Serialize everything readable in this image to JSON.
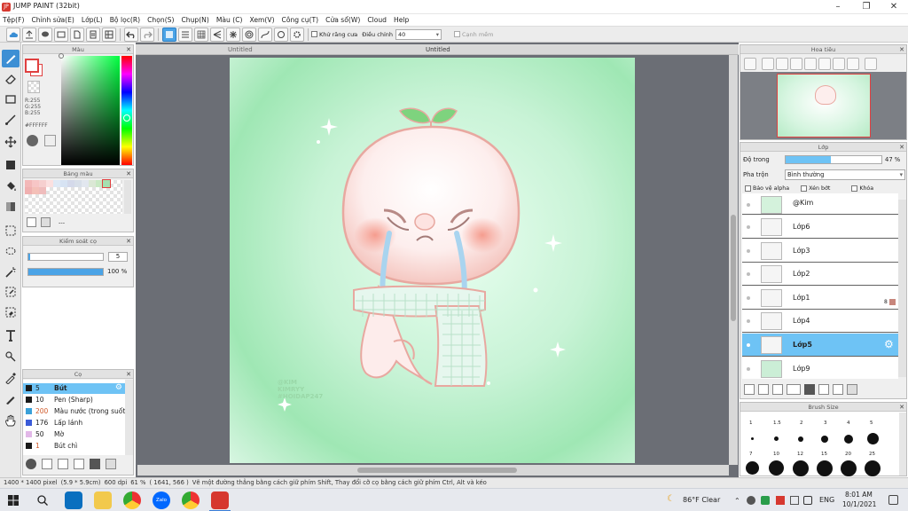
{
  "window": {
    "title": "JUMP PAINT (32bit)",
    "icon_text": "JP"
  },
  "menu": [
    "Tệp(F)",
    "Chỉnh sửa(E)",
    "Lớp(L)",
    "Bộ lọc(R)",
    "Chọn(S)",
    "Chụp(N)",
    "Màu (C)",
    "Xem(V)",
    "Công cụ(T)",
    "Cửa sổ(W)",
    "Cloud",
    "Help"
  ],
  "toolbar": {
    "antialias_label": "Khử răng cưa",
    "correction_label": "Điều chỉnh",
    "correction_value": "40",
    "edge_label": "Cạnh mềm"
  },
  "color_panel": {
    "title": "Màu",
    "r": "R:255",
    "g": "G:255",
    "b": "B:255",
    "hex": "#FFFFFF"
  },
  "swatch_panel": {
    "title": "Bảng màu",
    "dashes": "---"
  },
  "brush_control": {
    "title": "Kiểm soát cọ",
    "size": "5",
    "opacity": "100 %"
  },
  "brush_panel": {
    "title": "Cọ",
    "items": [
      {
        "size": "5",
        "name": "Bút",
        "color": "#1a1a1a"
      },
      {
        "size": "10",
        "name": "Pen (Sharp)",
        "color": "#1a1a1a"
      },
      {
        "size": "200",
        "name": "Màu nước (trong suốt)",
        "color": "#3aa0d8"
      },
      {
        "size": "176",
        "name": "Lấp lánh",
        "color": "#3a5bd8"
      },
      {
        "size": "50",
        "name": "Mờ",
        "color": "#e2b8e8"
      },
      {
        "size": "1",
        "name": "Bút chì",
        "color": "#1a1a1a"
      }
    ]
  },
  "document": {
    "tab_left": "Untitled",
    "tab_right": "Untitled"
  },
  "artwork": {
    "watermark_1": "@KIM",
    "watermark_2": "KIMRYY",
    "watermark_3": "#HOIDAP247"
  },
  "navigator": {
    "title": "Hoa tiêu"
  },
  "layers_panel": {
    "title": "Lớp",
    "opacity_label": "Độ trong",
    "opacity_value": "47 %",
    "blend_label": "Pha trộn",
    "blend_value": "Bình thường",
    "protect_alpha": "Bảo vệ alpha",
    "clipping": "Xén bớt",
    "lock": "Khóa",
    "layers": [
      {
        "name": "@Kim",
        "selected": false
      },
      {
        "name": "Lớp6",
        "selected": false
      },
      {
        "name": "Lớp3",
        "selected": false
      },
      {
        "name": "Lớp2",
        "selected": false
      },
      {
        "name": "Lớp1",
        "selected": false
      },
      {
        "name": "Lớp4",
        "selected": false
      },
      {
        "name": "Lớp5",
        "selected": true
      },
      {
        "name": "Lớp9",
        "selected": false
      }
    ],
    "layer1_badge": "8"
  },
  "brush_size_panel": {
    "title": "Brush Size",
    "row1": [
      "1",
      "1.5",
      "2",
      "3",
      "4",
      "5"
    ],
    "row2": [
      "7",
      "10",
      "12",
      "15",
      "20",
      "25"
    ]
  },
  "status": {
    "dimensions": "1400 * 1400 pixel",
    "physical": "(5.9 * 5.9cm)",
    "dpi": "600 dpi",
    "zoom": "61 %",
    "coords": "( 1641, 566 )",
    "hint": "Vẽ một đường thẳng bằng cách giữ phím Shift, Thay đổi cỡ cọ bằng cách giữ phím Ctrl, Alt và kéo"
  },
  "taskbar": {
    "weather": "86°F Clear",
    "lang": "ENG",
    "time": "8:01 AM",
    "date": "10/1/2021",
    "zalo": "Zalo"
  }
}
